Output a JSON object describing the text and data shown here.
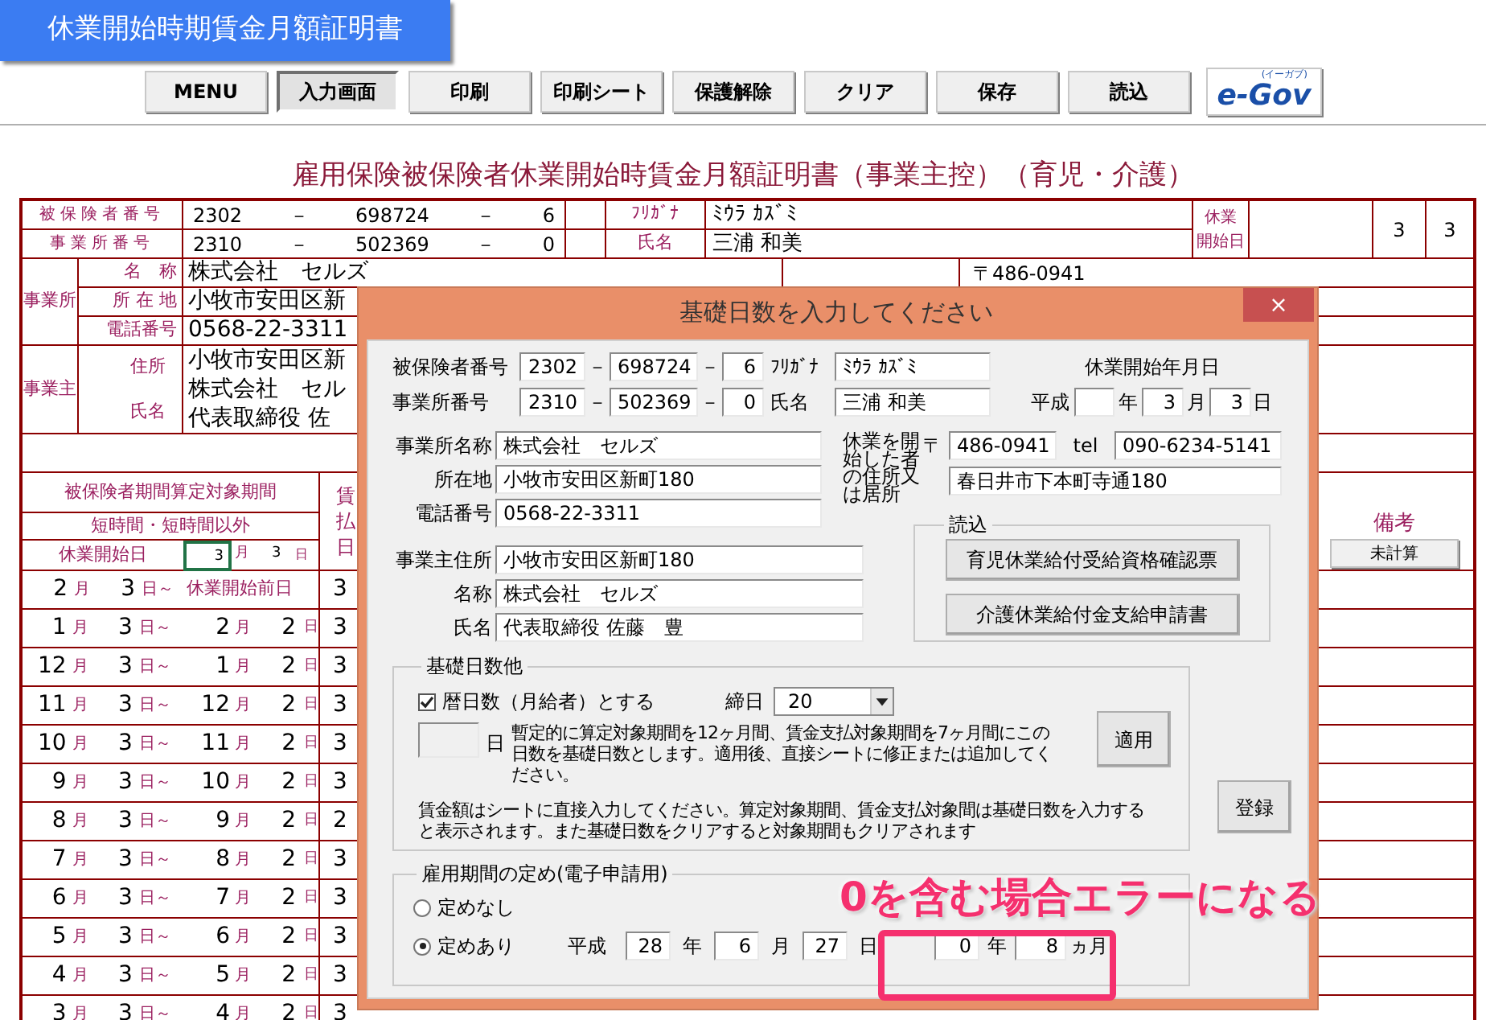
{
  "app_title": "休業開始時期賃金月額証明書",
  "toolbar": [
    {
      "label": "MENU",
      "selected": false
    },
    {
      "label": "入力画面",
      "selected": true
    },
    {
      "label": "印刷",
      "selected": false
    },
    {
      "label": "印刷シート",
      "selected": false
    },
    {
      "label": "保護解除",
      "selected": false
    },
    {
      "label": "クリア",
      "selected": false
    },
    {
      "label": "保存",
      "selected": false
    },
    {
      "label": "読込",
      "selected": false
    }
  ],
  "logo": {
    "text": "e-Gov",
    "sub": "(イーガブ)"
  },
  "sheet": {
    "heading": "雇用保険被保険者休業開始時賃金月額証明書（事業主控）（育児・介護）",
    "id_rows": [
      {
        "label": "被保険者番号",
        "parts": [
          "2302",
          "－",
          "698724",
          "－",
          "6"
        ],
        "name_label": "ﾌﾘｶﾞﾅ",
        "name": "ﾐｳﾗ ｶｽﾞﾐ"
      },
      {
        "label": "事業所番号",
        "parts": [
          "2310",
          "－",
          "502369",
          "－",
          "0"
        ],
        "name_label": "氏名",
        "name": "三浦 和美"
      }
    ],
    "start_label": [
      "休業",
      "開始日"
    ],
    "start_month": "3",
    "start_day": "3",
    "office": {
      "group_label": "事業所",
      "rows": [
        {
          "label": "名　称",
          "value": "株式会社　セルズ"
        },
        {
          "label": "所 在 地",
          "value": "小牧市安田区新"
        },
        {
          "label": "電話番号",
          "value": "0568-22-3311"
        }
      ],
      "postal": "〒486-0941"
    },
    "employer": {
      "group_label": "事業主",
      "labels": [
        "住所",
        "氏名"
      ],
      "lines": [
        "小牧市安田区新",
        "株式会社　セル",
        "代表取締役 佐"
      ]
    },
    "period": {
      "title": "被保険者期間算定対象期間",
      "subtitle": "短時間・短時間以外",
      "start_label": "休業開始日",
      "start_month": "3",
      "start_month_active": true,
      "month_unit": "月",
      "start_day": "3",
      "day_unit": "日",
      "column_3_header": [
        "賃",
        "払",
        "日"
      ],
      "rows": [
        {
          "from": [
            "2",
            "月",
            "3",
            "日～"
          ],
          "to_label": "休業開始前日",
          "column_3": "3"
        },
        {
          "from": [
            "1",
            "月",
            "3",
            "日～"
          ],
          "to": [
            "2",
            "月",
            "2",
            "日"
          ],
          "column_3": "3"
        },
        {
          "from": [
            "12",
            "月",
            "3",
            "日～"
          ],
          "to": [
            "1",
            "月",
            "2",
            "日"
          ],
          "column_3": "3"
        },
        {
          "from": [
            "11",
            "月",
            "3",
            "日～"
          ],
          "to": [
            "12",
            "月",
            "2",
            "日"
          ],
          "column_3": "3"
        },
        {
          "from": [
            "10",
            "月",
            "3",
            "日～"
          ],
          "to": [
            "11",
            "月",
            "2",
            "日"
          ],
          "column_3": "3"
        },
        {
          "from": [
            "9",
            "月",
            "3",
            "日～"
          ],
          "to": [
            "10",
            "月",
            "2",
            "日"
          ],
          "column_3": "3"
        },
        {
          "from": [
            "8",
            "月",
            "3",
            "日～"
          ],
          "to": [
            "9",
            "月",
            "2",
            "日"
          ],
          "column_3": "2"
        },
        {
          "from": [
            "7",
            "月",
            "3",
            "日～"
          ],
          "to": [
            "8",
            "月",
            "2",
            "日"
          ],
          "column_3": "3"
        },
        {
          "from": [
            "6",
            "月",
            "3",
            "日～"
          ],
          "to": [
            "7",
            "月",
            "2",
            "日"
          ],
          "column_3": "3"
        },
        {
          "from": [
            "5",
            "月",
            "3",
            "日～"
          ],
          "to": [
            "6",
            "月",
            "2",
            "日"
          ],
          "column_3": "3"
        },
        {
          "from": [
            "4",
            "月",
            "3",
            "日～"
          ],
          "to": [
            "5",
            "月",
            "2",
            "日"
          ],
          "column_3": "3"
        },
        {
          "from": [
            "3",
            "月",
            "3",
            "日～"
          ],
          "to": [
            "4",
            "月",
            "2",
            "日"
          ],
          "column_3": "3"
        }
      ],
      "remarks_label": "備考",
      "calc_button": "未計算"
    }
  },
  "dialog": {
    "title": "基礎日数を入力してください",
    "close": "×",
    "id_rows": [
      {
        "label": "被保険者番号",
        "parts": [
          "2302",
          "－",
          "698724",
          "－",
          "6"
        ],
        "name_label": "ﾌﾘｶﾞﾅ",
        "name": "ﾐｳﾗ ｶｽﾞﾐ"
      },
      {
        "label": "事業所番号",
        "parts": [
          "2310",
          "－",
          "502369",
          "－",
          "0"
        ],
        "name_label": "氏名",
        "name": "三浦 和美"
      }
    ],
    "start_date": {
      "label": "休業開始年月日",
      "era": "平成",
      "year_unit": "年",
      "month": "3",
      "month_unit": "月",
      "day": "3",
      "day_unit": "日"
    },
    "office_fields": [
      {
        "label": "事業所名称",
        "value": "株式会社　セルズ"
      },
      {
        "label": "所在地",
        "value": "小牧市安田区新町180"
      },
      {
        "label": "電話番号",
        "value": "0568-22-3311"
      }
    ],
    "person_address": {
      "label": "休業を開始した者の住所又は居所",
      "postal_mark": "〒",
      "postal": "486-0941",
      "tel_label": "tel",
      "tel": "090-6234-5141",
      "address": "春日井市下本町寺通180"
    },
    "employer_fields": [
      {
        "label": "事業主住所",
        "value": "小牧市安田区新町180"
      },
      {
        "label": "名称",
        "value": "株式会社　セルズ"
      },
      {
        "label": "氏名",
        "value": "代表取締役 佐藤　豊"
      }
    ],
    "load_group": {
      "title": "読込",
      "buttons": [
        "育児休業給付受給資格確認票",
        "介護休業給付金支給申請書"
      ]
    },
    "base_days": {
      "title": "基礎日数他",
      "calendar_days": {
        "label": "暦日数（月給者）とする",
        "checked": true
      },
      "closing_label": "締日",
      "closing_value": "20",
      "days_unit": "日",
      "note": "暫定的に算定対象期間を12ヶ月間、賃金支払対象期間を7ヶ月間にこの日数を基礎日数とします。適用後、直接シートに修正または追加してください。",
      "apply": "適用",
      "info": "賃金額はシートに直接入力してください。算定対象期間、賃金支払対象間は基礎日数を入力すると表示されます。また基礎日数をクリアすると対象期間もクリアされます"
    },
    "register": "登録",
    "employment": {
      "title": "雇用期間の定め(電子申請用)",
      "options": [
        {
          "label": "定めなし",
          "selected": false
        },
        {
          "label": "定めあり",
          "selected": true
        }
      ],
      "era": "平成",
      "year": "28",
      "year_unit": "年",
      "month": "6",
      "month_unit": "月",
      "day": "27",
      "day_unit": "日",
      "period_years": "0",
      "period_years_unit": "年",
      "period_months": "8",
      "period_months_unit": "ヵ月"
    }
  },
  "callout": {
    "text": "0を含む場合エラーになる"
  }
}
